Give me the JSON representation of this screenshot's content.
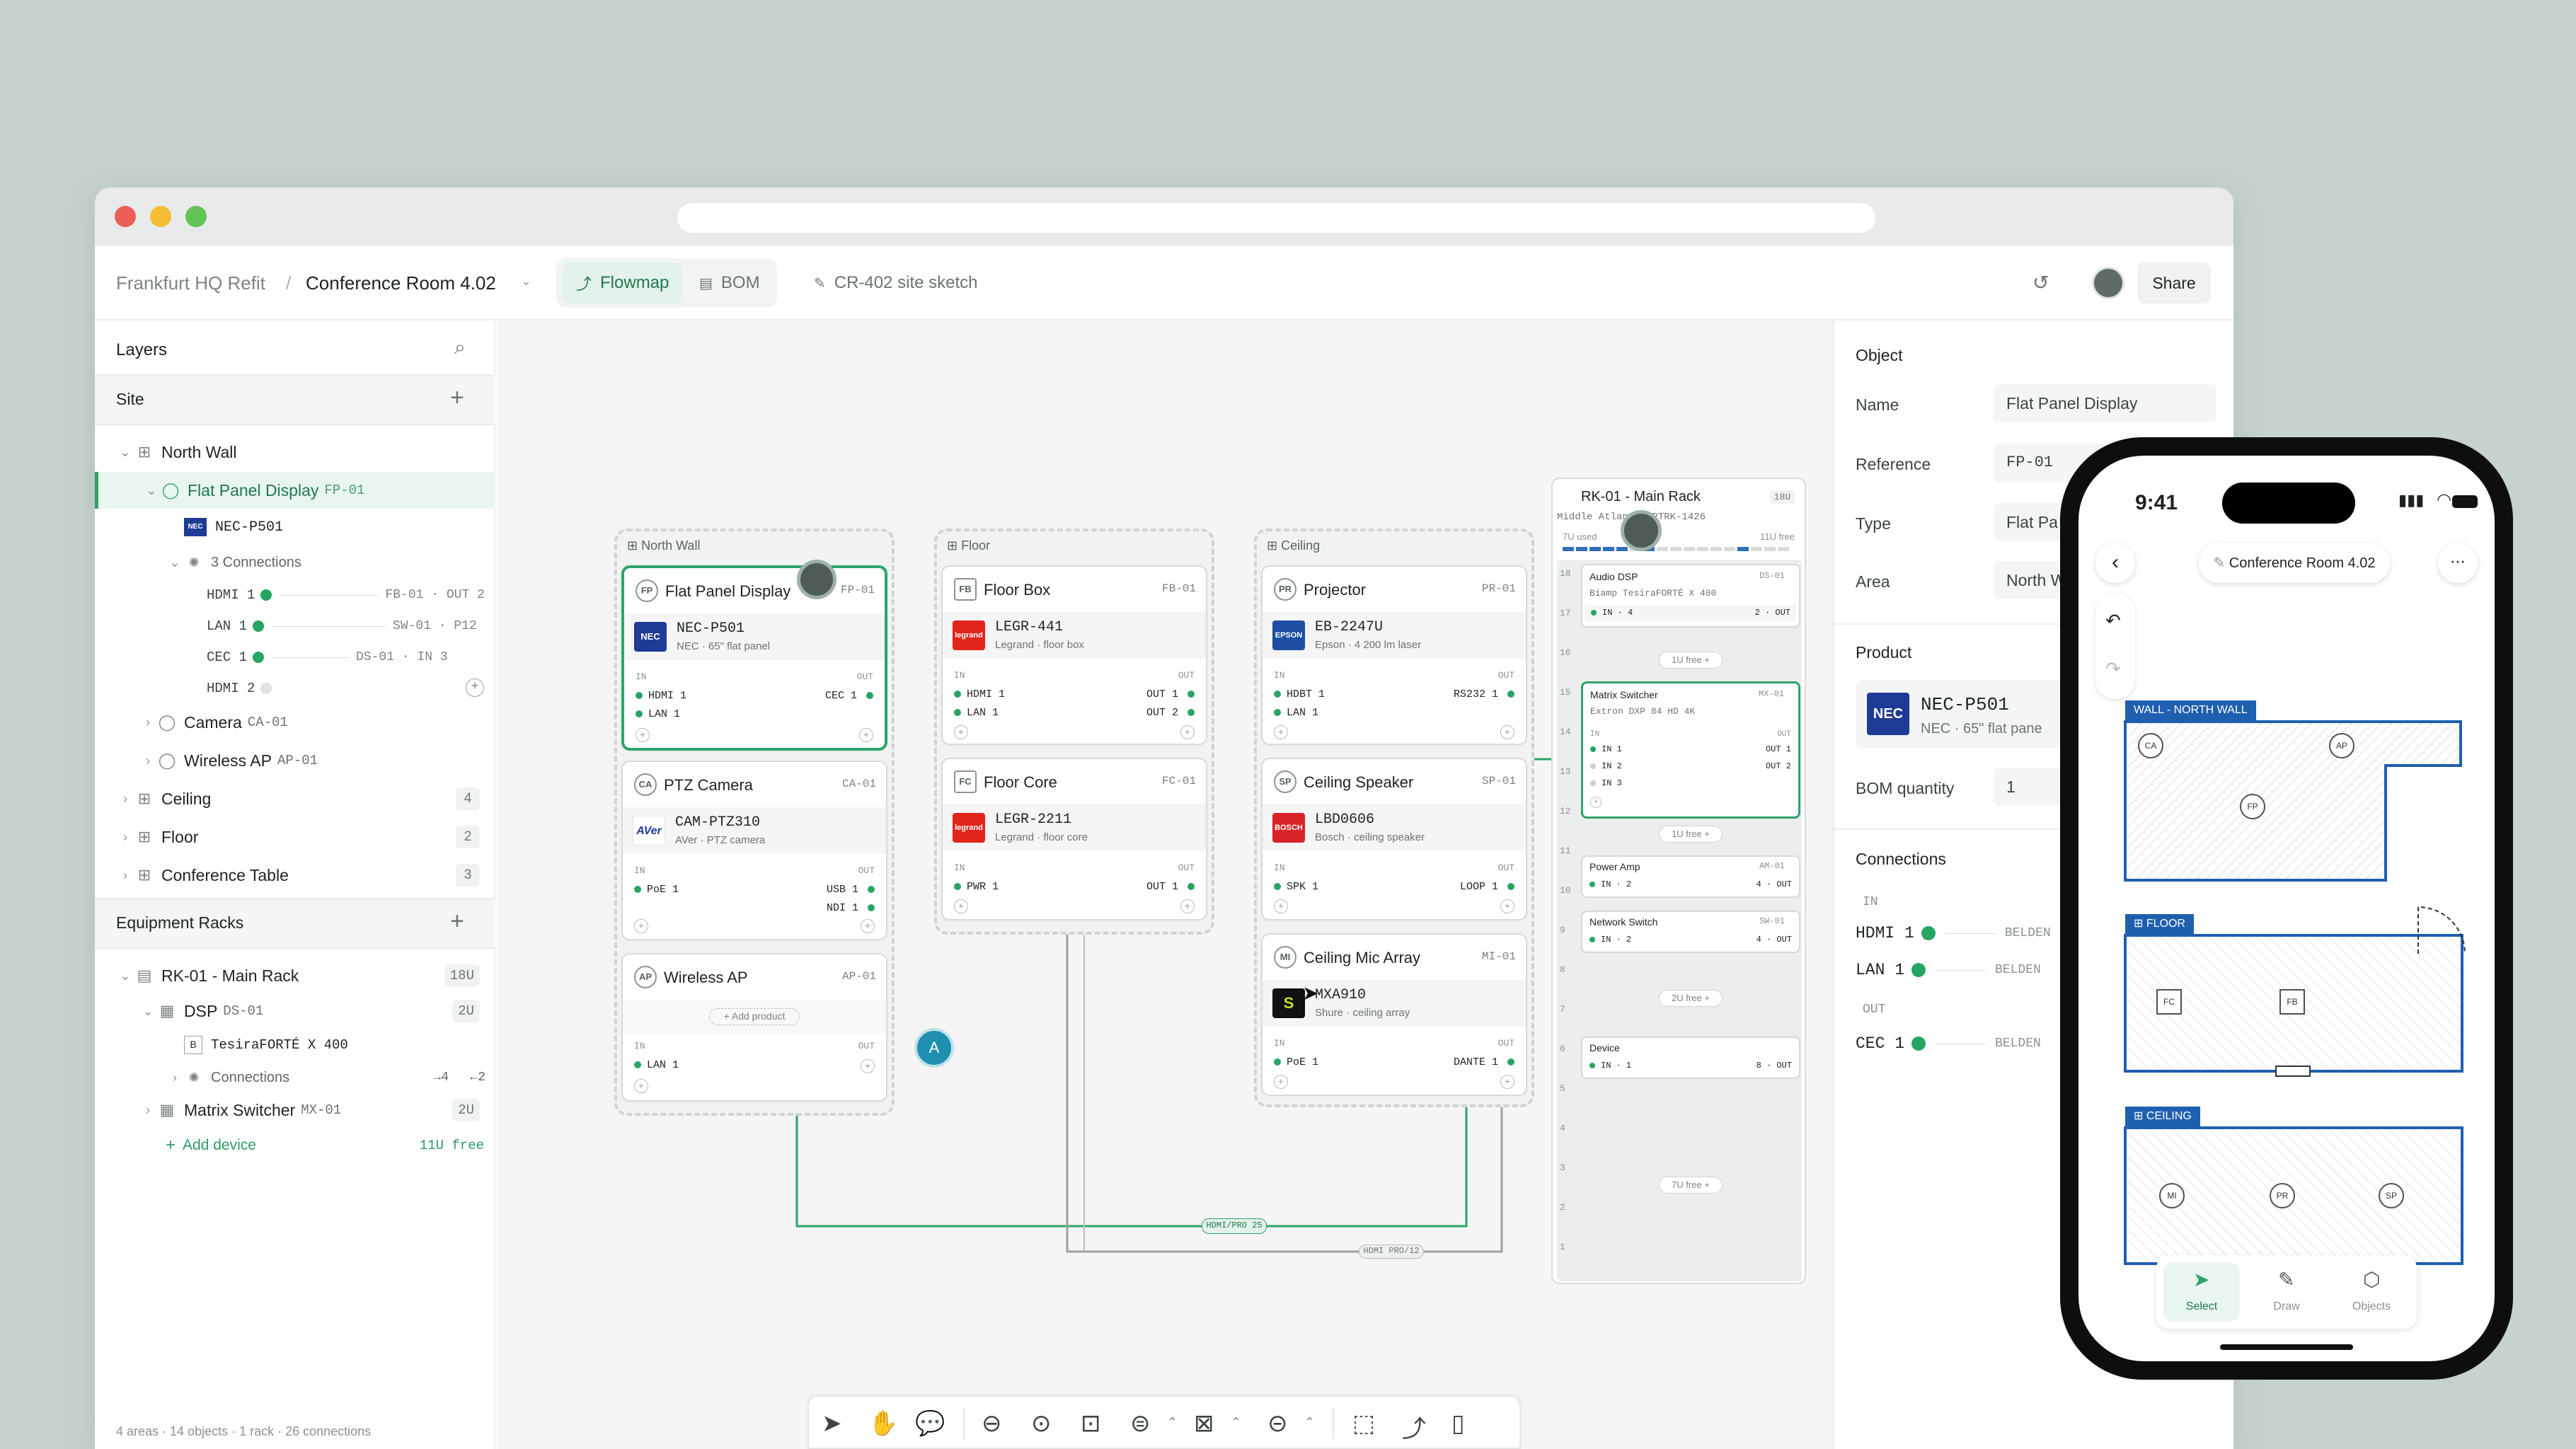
{
  "breadcrumb": {
    "project": "Frankfurt HQ Refit",
    "separator": "/",
    "room": "Conference Room 4.02"
  },
  "tabs": {
    "flowmap": "Flowmap",
    "bom": "BOM",
    "sketch": "CR-402 site sketch"
  },
  "share": "Share",
  "layers": {
    "title": "Layers",
    "site_label": "Site",
    "north_wall": "North Wall",
    "fpd": {
      "name": "Flat Panel Display",
      "code": "FP-01",
      "product": "NEC-P501",
      "connections": "3 Connections"
    },
    "conns": [
      {
        "port": "HDMI 1",
        "target": "FB-01 · OUT 2"
      },
      {
        "port": "LAN 1",
        "target": "SW-01 · P12"
      },
      {
        "port": "CEC 1",
        "target": "DS-01 · IN 3"
      },
      {
        "port": "HDMI 2",
        "target": ""
      }
    ],
    "camera": {
      "name": "Camera",
      "code": "CA-01"
    },
    "wap": {
      "name": "Wireless AP",
      "code": "AP-01"
    },
    "ceiling": {
      "name": "Ceiling",
      "count": "4"
    },
    "floor": {
      "name": "Floor",
      "count": "2"
    },
    "table": {
      "name": "Conference Table",
      "count": "3"
    },
    "racks_label": "Equipment Racks",
    "rack": {
      "name": "RK-01 - Main Rack",
      "size": "18U"
    },
    "dsp": {
      "name": "DSP",
      "code": "DS-01",
      "size": "2U",
      "product": "TesiraFORTÉ X 400",
      "connections": "Connections",
      "in": "→4",
      "out": "←2"
    },
    "matrix": {
      "name": "Matrix Switcher",
      "code": "MX-01",
      "size": "2U"
    },
    "add_device": "Add device",
    "free": "11U free",
    "footer": "4 areas · 14 objects · 1 rack · 26 connections"
  },
  "canvas": {
    "areas": {
      "north": "North Wall",
      "floor": "Floor",
      "ceiling": "Ceiling"
    },
    "io_in": "IN",
    "io_out": "OUT",
    "cards": {
      "fpd": {
        "title": "Flat Panel Display",
        "code": "FP-01",
        "icon": "FP",
        "logo": "NEC",
        "model": "NEC-P501",
        "sub": "NEC · 65\" flat panel",
        "in": [
          "HDMI 1",
          "LAN 1"
        ],
        "out": [
          "CEC 1"
        ]
      },
      "ptz": {
        "title": "PTZ Camera",
        "code": "CA-01",
        "icon": "CA",
        "logo": "AVer",
        "model": "CAM-PTZ310",
        "sub": "AVer · PTZ camera",
        "in": [
          "PoE 1"
        ],
        "out": [
          "USB 1",
          "NDI 1"
        ]
      },
      "wap": {
        "title": "Wireless AP",
        "code": "AP-01",
        "icon": "AP",
        "add": "+ Add product",
        "in": [
          "LAN 1"
        ]
      },
      "fbox": {
        "title": "Floor Box",
        "code": "FB-01",
        "icon": "FB",
        "logo": "legrand",
        "model": "LEGR-441",
        "sub": "Legrand · floor box",
        "in": [
          "HDMI 1",
          "LAN 1"
        ],
        "out": [
          "OUT 1",
          "OUT 2"
        ]
      },
      "fcore": {
        "title": "Floor Core",
        "code": "FC-01",
        "icon": "FC",
        "logo": "legrand",
        "model": "LEGR-2211",
        "sub": "Legrand · floor core",
        "in": [
          "PWR 1"
        ],
        "out": [
          "OUT 1"
        ]
      },
      "proj": {
        "title": "Projector",
        "code": "PR-01",
        "icon": "PR",
        "logo": "EPSON",
        "model": "EB-2247U",
        "sub": "Epson · 4 200 lm laser",
        "in": [
          "HDBT 1",
          "LAN 1"
        ],
        "out": [
          "RS232 1"
        ]
      },
      "spk": {
        "title": "Ceiling Speaker",
        "code": "SP-01",
        "icon": "SP",
        "logo": "BOSCH",
        "model": "LBD0606",
        "sub": "Bosch · ceiling speaker",
        "in": [
          "SPK 1"
        ],
        "out": [
          "LOOP 1"
        ]
      },
      "mic": {
        "title": "Ceiling Mic Array",
        "code": "MI-01",
        "icon": "MI",
        "logo": "S",
        "model": "MXA910",
        "sub": "Shure · ceiling array",
        "in": [
          "PoE 1"
        ],
        "out": [
          "DANTE 1"
        ]
      }
    },
    "avatar_a": "A",
    "cable1": "HDMI/PRO 25",
    "cable2": "HDMI PRO/12",
    "rack": {
      "title": "RK-01 - Main Rack",
      "size": "18U",
      "model": "Middle Atlantic PTRK-1426",
      "used": "7U used",
      "freeu": "11U free",
      "dsp": {
        "name": "Audio DSP",
        "code": "DS-01",
        "model": "Biamp TesiraFORTÉ X 400",
        "in": "IN · 4",
        "out": "2 · OUT"
      },
      "free1": "1U free +",
      "mx": {
        "name": "Matrix Switcher",
        "code": "MX-01",
        "model": "Extron DXP 84 HD 4K",
        "in": [
          "IN 1",
          "IN 2",
          "IN 3"
        ],
        "out": [
          "OUT 1",
          "OUT 2"
        ]
      },
      "free2": "1U free +",
      "amp": {
        "name": "Power Amp",
        "code": "AM-01",
        "in": "IN · 2",
        "out": "4 · OUT"
      },
      "sw": {
        "name": "Network Switch",
        "code": "SW-01",
        "in": "IN · 2",
        "out": "4 · OUT"
      },
      "free3": "2U free +",
      "dev": {
        "name": "Device",
        "in": "IN · 1",
        "out": "8 · OUT"
      },
      "free4": "7U free +",
      "numbers": [
        "18",
        "17",
        "16",
        "15",
        "14",
        "13",
        "12",
        "11",
        "10",
        "9",
        "8",
        "7",
        "6",
        "5",
        "4",
        "3",
        "2",
        "1"
      ]
    }
  },
  "inspector": {
    "object": "Object",
    "name_label": "Name",
    "name": "Flat Panel Display",
    "ref_label": "Reference",
    "ref": "FP-01",
    "type_label": "Type",
    "type": "Flat Pa",
    "area_label": "Area",
    "area": "North W",
    "product_label": "Product",
    "logo": "NEC",
    "model": "NEC-P501",
    "sub": "NEC · 65\" flat pane",
    "bom_label": "BOM quantity",
    "bom": "1",
    "conn_label": "Connections",
    "in": "IN",
    "out": "OUT",
    "conns": [
      {
        "port": "HDMI 1",
        "cable": "BELDEN"
      },
      {
        "port": "LAN 1",
        "cable": "BELDEN"
      },
      {
        "port": "CEC 1",
        "cable": "BELDEN"
      }
    ]
  },
  "phone": {
    "time": "9:41",
    "title": "Conference Room 4.02",
    "zones": {
      "north": "WALL - NORTH WALL",
      "floor": "FLOOR",
      "ceiling": "CEILING"
    },
    "devices": {
      "ca": "CA",
      "ap": "AP",
      "fp": "FP",
      "fc": "FC",
      "fb": "FB",
      "mi": "MI",
      "pr": "PR",
      "sp": "SP"
    },
    "tabs": {
      "select": "Select",
      "draw": "Draw",
      "objects": "Objects"
    }
  },
  "colors": {
    "accent": "#2ea46b",
    "accent_bg": "#e9f5ef",
    "blue": "#1f5fb0"
  }
}
